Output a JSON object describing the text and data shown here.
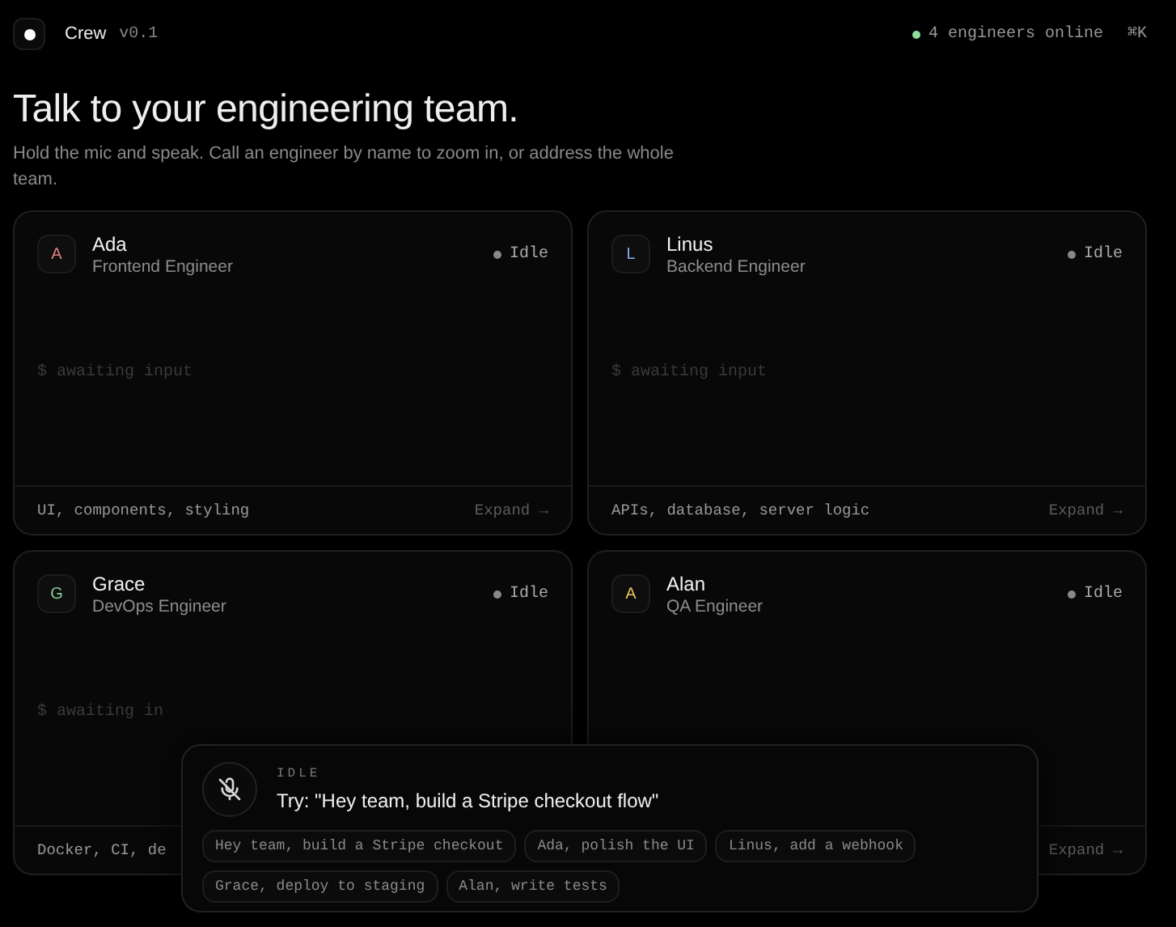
{
  "header": {
    "brand": "Crew",
    "version": "v0.1",
    "online": "4 engineers online",
    "shortcut": "⌘K"
  },
  "hero": {
    "title": "Talk to your engineering team.",
    "subtitle": "Hold the mic and speak. Call an engineer by name to zoom in, or address the whole team."
  },
  "engineers": [
    {
      "initial": "A",
      "name": "Ada",
      "role": "Frontend Engineer",
      "color": "#e08080",
      "status": "Idle",
      "terminal": "$ awaiting input",
      "tags": "UI, components, styling",
      "action": "Expand →"
    },
    {
      "initial": "L",
      "name": "Linus",
      "role": "Backend Engineer",
      "color": "#88aee8",
      "status": "Idle",
      "terminal": "$ awaiting input",
      "tags": "APIs, database, server logic",
      "action": "Expand →"
    },
    {
      "initial": "G",
      "name": "Grace",
      "role": "DevOps Engineer",
      "color": "#86d098",
      "status": "Idle",
      "terminal": "$ awaiting in",
      "tags": "Docker, CI, de"
    },
    {
      "initial": "A",
      "name": "Alan",
      "role": "QA Engineer",
      "color": "#e8c25a",
      "status": "Idle",
      "action": "Expand →"
    }
  ],
  "voice": {
    "status": "IDLE",
    "prompt": "Try: \"Hey team, build a Stripe checkout flow\"",
    "suggestions": [
      "Hey team, build a Stripe checkout",
      "Ada, polish the UI",
      "Linus, add a webhook",
      "Grace, deploy to staging",
      "Alan, write tests"
    ]
  }
}
